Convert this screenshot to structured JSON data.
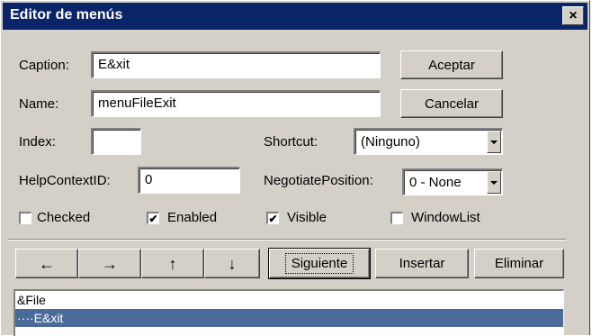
{
  "window": {
    "title": "Editor de menús",
    "close_glyph": "×"
  },
  "form": {
    "caption_label": "Caption:",
    "caption_value": "E&xit",
    "name_label": "Name:",
    "name_value": "menuFileExit",
    "index_label": "Index:",
    "index_value": "",
    "shortcut_label": "Shortcut:",
    "shortcut_value": "(Ninguno)",
    "helpcontext_label": "HelpContextID:",
    "helpcontext_value": "0",
    "negotiate_label": "NegotiatePosition:",
    "negotiate_value": "0 - None"
  },
  "buttons": {
    "accept": "Aceptar",
    "cancel": "Cancelar",
    "next": "Siguiente",
    "insert": "Insertar",
    "delete": "Eliminar"
  },
  "checkboxes": [
    {
      "label": "Checked",
      "checked": false,
      "mark": ""
    },
    {
      "label": "Enabled",
      "checked": true,
      "mark": "✔"
    },
    {
      "label": "Visible",
      "checked": true,
      "mark": "✔"
    },
    {
      "label": "WindowList",
      "checked": false,
      "mark": ""
    }
  ],
  "arrows": {
    "left": "←",
    "right": "→",
    "up": "↑",
    "down": "↓"
  },
  "menu_list": [
    {
      "text": "&File",
      "selected": false
    },
    {
      "text": "····E&xit",
      "selected": true
    }
  ],
  "colors": {
    "titlebar": "#0a246a",
    "face": "#d4d0c8",
    "selection": "#4a6a9a"
  }
}
